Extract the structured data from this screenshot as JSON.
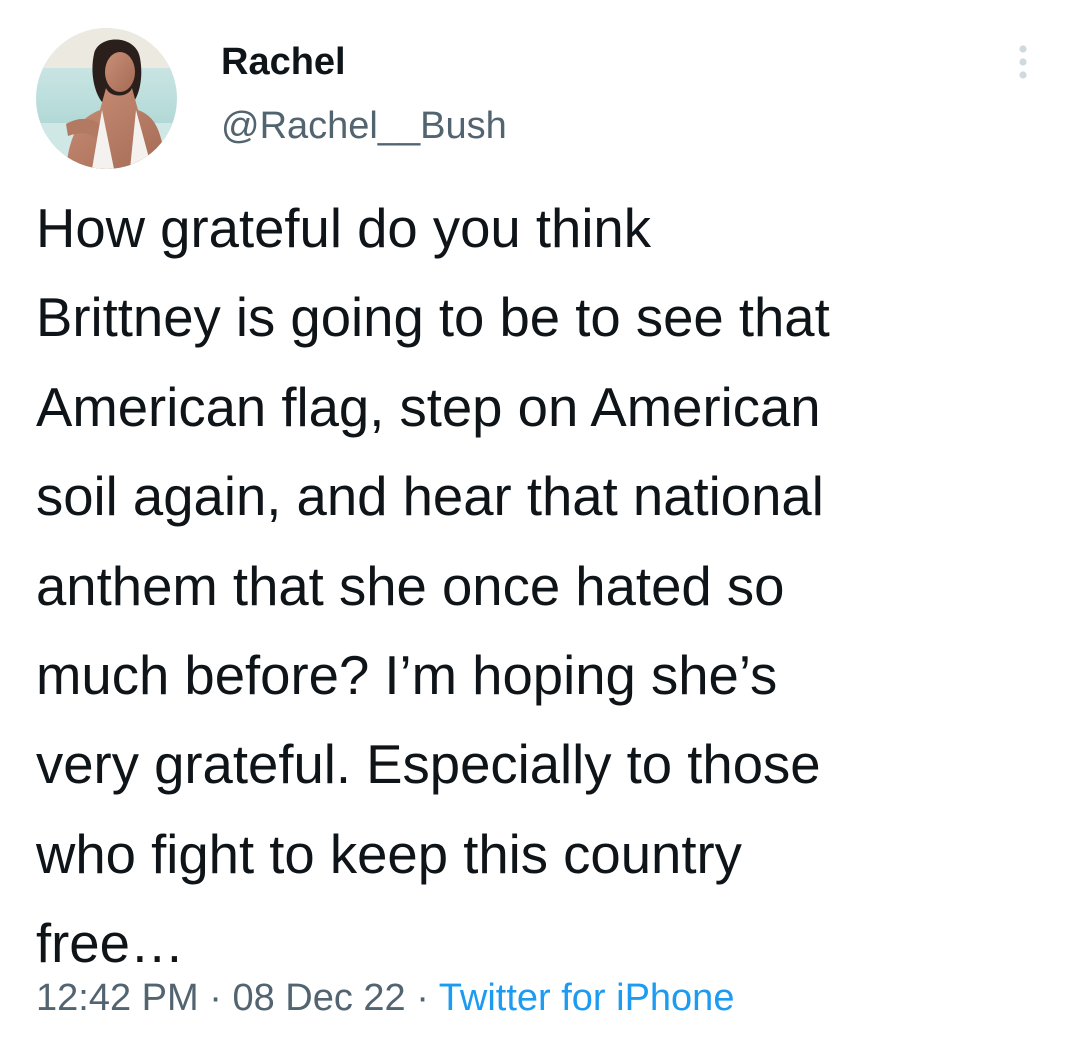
{
  "tweet": {
    "author": {
      "display_name": "Rachel",
      "handle": "@Rachel__Bush"
    },
    "text_lines": [
      "How grateful do you think",
      "Brittney is going to be to see that",
      "American flag, step on American",
      "soil again, and hear that national",
      "anthem that she once hated so",
      "much before? I’m hoping she’s",
      "very grateful. Especially to those",
      "who fight to keep this country",
      "free…"
    ],
    "time": "12:42 PM",
    "date": "08 Dec 22",
    "separator": "·",
    "source": "Twitter for iPhone"
  },
  "icons": {
    "more": "more-options-icon",
    "avatar": "profile-photo"
  },
  "colors": {
    "text_primary": "#0f1419",
    "text_secondary": "#536471",
    "link": "#1d9bf0",
    "more_icon": "#cfd9de"
  }
}
